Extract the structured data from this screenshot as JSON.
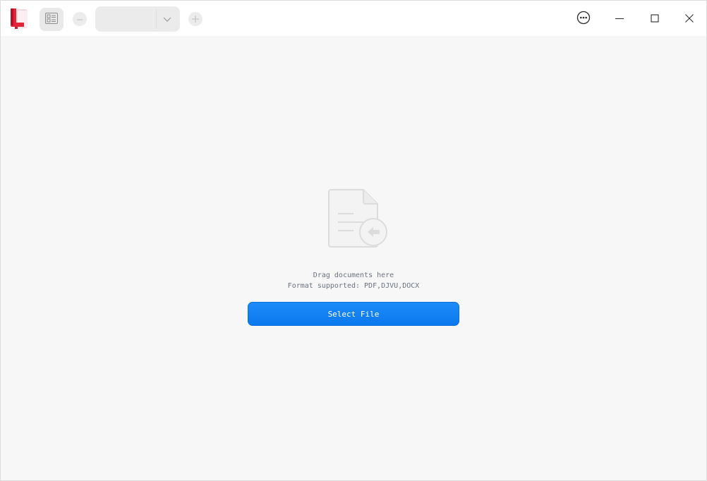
{
  "titlebar": {
    "zoom_value": "",
    "icons": {
      "logo": "app-logo-icon",
      "thumbnails": "thumbnails-icon",
      "zoom_out": "minus-icon",
      "zoom_dropdown": "chevron-down-icon",
      "zoom_in": "plus-icon",
      "menu": "more-options-icon",
      "minimize": "minimize-icon",
      "maximize": "maximize-icon",
      "close": "close-icon"
    }
  },
  "empty_state": {
    "icon": "document-import-icon",
    "drag_hint": "Drag documents here",
    "formats_hint": "Format supported: PDF,DJVU,DOCX",
    "select_button_label": "Select File"
  },
  "colors": {
    "accent": "#0b78ee",
    "logo_red": "#e0243a",
    "background": "#f7f7f7"
  }
}
